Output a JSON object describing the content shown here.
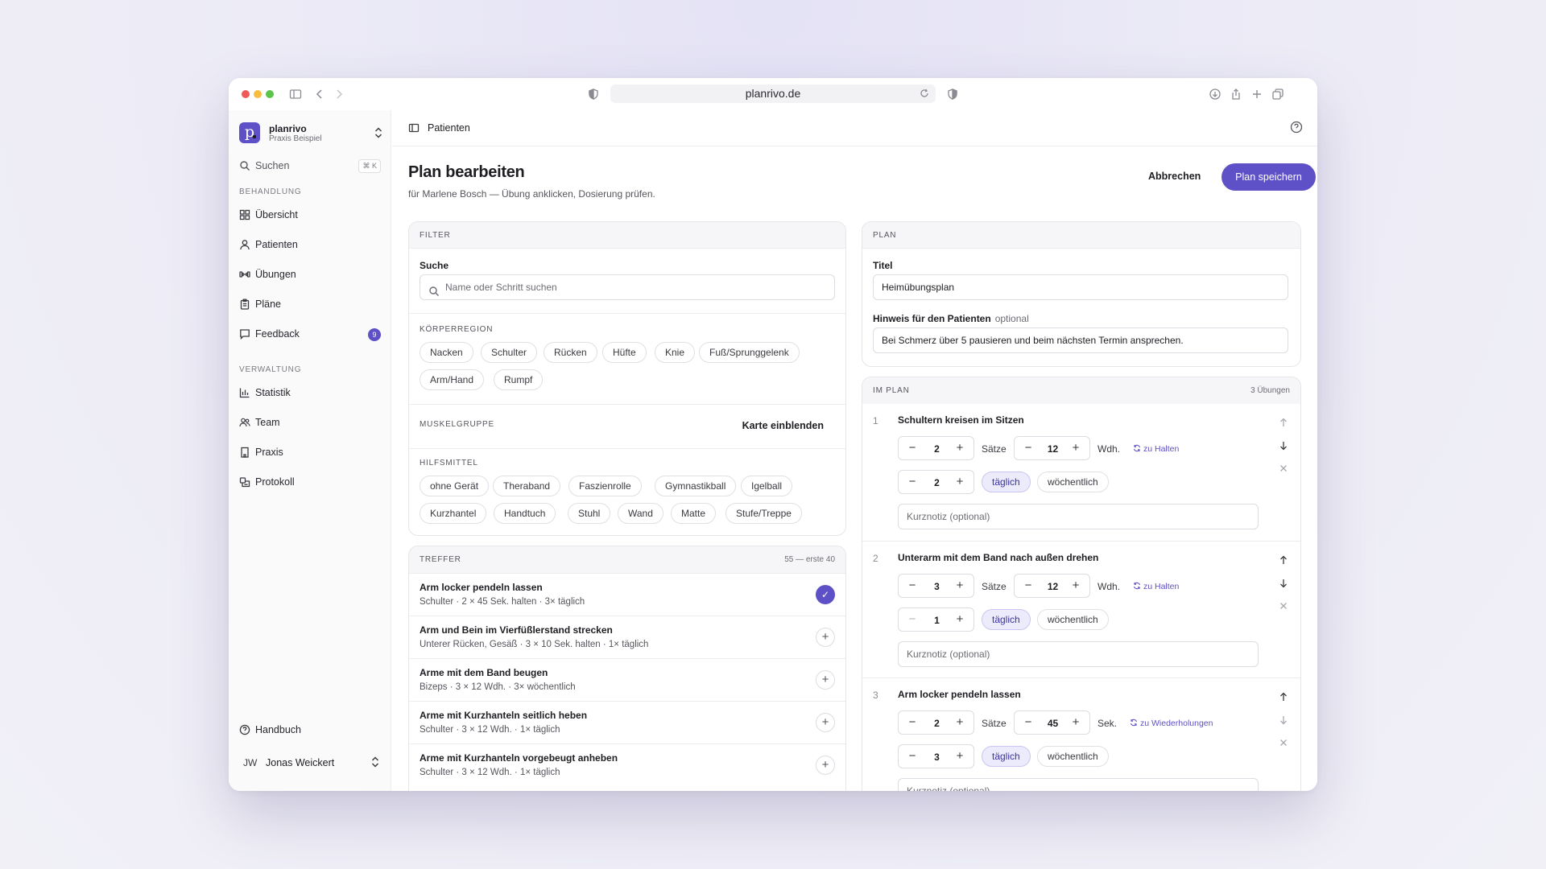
{
  "browser": {
    "url": "planrivo.de",
    "traffic_colors": [
      "#ee5b57",
      "#f6bd3f",
      "#5ac54a"
    ]
  },
  "sidebar": {
    "brand_name": "planrivo",
    "brand_sub": "Praxis Beispiel",
    "brand_logo": "p",
    "search_label": "Suchen",
    "search_shortcut": "⌘ K",
    "section_treatment": "BEHANDLUNG",
    "section_admin": "VERWALTUNG",
    "items": [
      {
        "label": "Übersicht",
        "icon": "grid-icon"
      },
      {
        "label": "Patienten",
        "icon": "user-icon"
      },
      {
        "label": "Übungen",
        "icon": "dumbbell-icon"
      },
      {
        "label": "Pläne",
        "icon": "clipboard-icon"
      },
      {
        "label": "Feedback",
        "icon": "message-icon",
        "badge": "9"
      },
      {
        "label": "Statistik",
        "icon": "chart-icon"
      },
      {
        "label": "Team",
        "icon": "users-icon"
      },
      {
        "label": "Praxis",
        "icon": "building-icon"
      },
      {
        "label": "Protokoll",
        "icon": "history-icon"
      }
    ],
    "manual": "Handbuch",
    "user_initials": "JW",
    "user_name": "Jonas Weickert"
  },
  "topbar": {
    "breadcrumb": "Patienten"
  },
  "page": {
    "title": "Plan bearbeiten",
    "subtitle": "für Marlene Bosch — Übung anklicken, Dosierung prüfen.",
    "cancel": "Abbrechen",
    "save": "Plan speichern"
  },
  "filter": {
    "header": "FILTER",
    "search_label": "Suche",
    "search_placeholder": "Name oder Schritt suchen",
    "region_label": "KÖRPERREGION",
    "regions": [
      "Nacken",
      "Schulter",
      "Rücken",
      "Hüfte",
      "Knie",
      "Fuß/Sprunggelenk",
      "Arm/Hand",
      "Rumpf"
    ],
    "muscle_label": "MUSKELGRUPPE",
    "muscle_action": "Karte einblenden",
    "aids_label": "HILFSMITTEL",
    "aids": [
      "ohne Gerät",
      "Theraband",
      "Faszienrolle",
      "Gymnastikball",
      "Igelball",
      "Kurzhantel",
      "Handtuch",
      "Stuhl",
      "Wand",
      "Matte",
      "Stufe/Treppe"
    ]
  },
  "hits": {
    "header": "TREFFER",
    "count": "55 — erste 40",
    "items": [
      {
        "title": "Arm locker pendeln lassen",
        "meta": "Schulter · 2 × 45 Sek. halten · 3× täglich",
        "selected": true
      },
      {
        "title": "Arm und Bein im Vierfüßlerstand strecken",
        "meta": "Unterer Rücken, Gesäß · 3 × 10 Sek. halten · 1× täglich",
        "selected": false
      },
      {
        "title": "Arme mit dem Band beugen",
        "meta": "Bizeps · 3 × 12 Wdh. · 3× wöchentlich",
        "selected": false
      },
      {
        "title": "Arme mit Kurzhanteln seitlich heben",
        "meta": "Schulter · 3 × 12 Wdh. · 1× täglich",
        "selected": false
      },
      {
        "title": "Arme mit Kurzhanteln vorgebeugt anheben",
        "meta": "Schulter · 3 × 12 Wdh. · 1× täglich",
        "selected": false
      }
    ]
  },
  "plan": {
    "header": "PLAN",
    "title_label": "Titel",
    "title_value": "Heimübungsplan",
    "hint_label": "Hinweis für den Patienten",
    "hint_optional": "optional",
    "hint_value": "Bei Schmerz über 5 pausieren und beim nächsten Termin ansprechen."
  },
  "inplan": {
    "header": "IM PLAN",
    "count": "3 Übungen",
    "sets_unit": "Sätze",
    "daily": "täglich",
    "weekly": "wöchentlich",
    "note_placeholder": "Kurznotiz (optional)",
    "exercises": [
      {
        "num": "1",
        "title": "Schultern kreisen im Sitzen",
        "sets": "2",
        "amount": "12",
        "amount_unit": "Wdh.",
        "toggle": "zu Halten",
        "freq": "2"
      },
      {
        "num": "2",
        "title": "Unterarm mit dem Band nach außen drehen",
        "sets": "3",
        "amount": "12",
        "amount_unit": "Wdh.",
        "toggle": "zu Halten",
        "freq": "1"
      },
      {
        "num": "3",
        "title": "Arm locker pendeln lassen",
        "sets": "2",
        "amount": "45",
        "amount_unit": "Sek.",
        "toggle": "zu Wiederholungen",
        "freq": "3"
      }
    ]
  },
  "colors": {
    "accent": "#5e50c6",
    "accent_soft": "#ecebfb"
  }
}
